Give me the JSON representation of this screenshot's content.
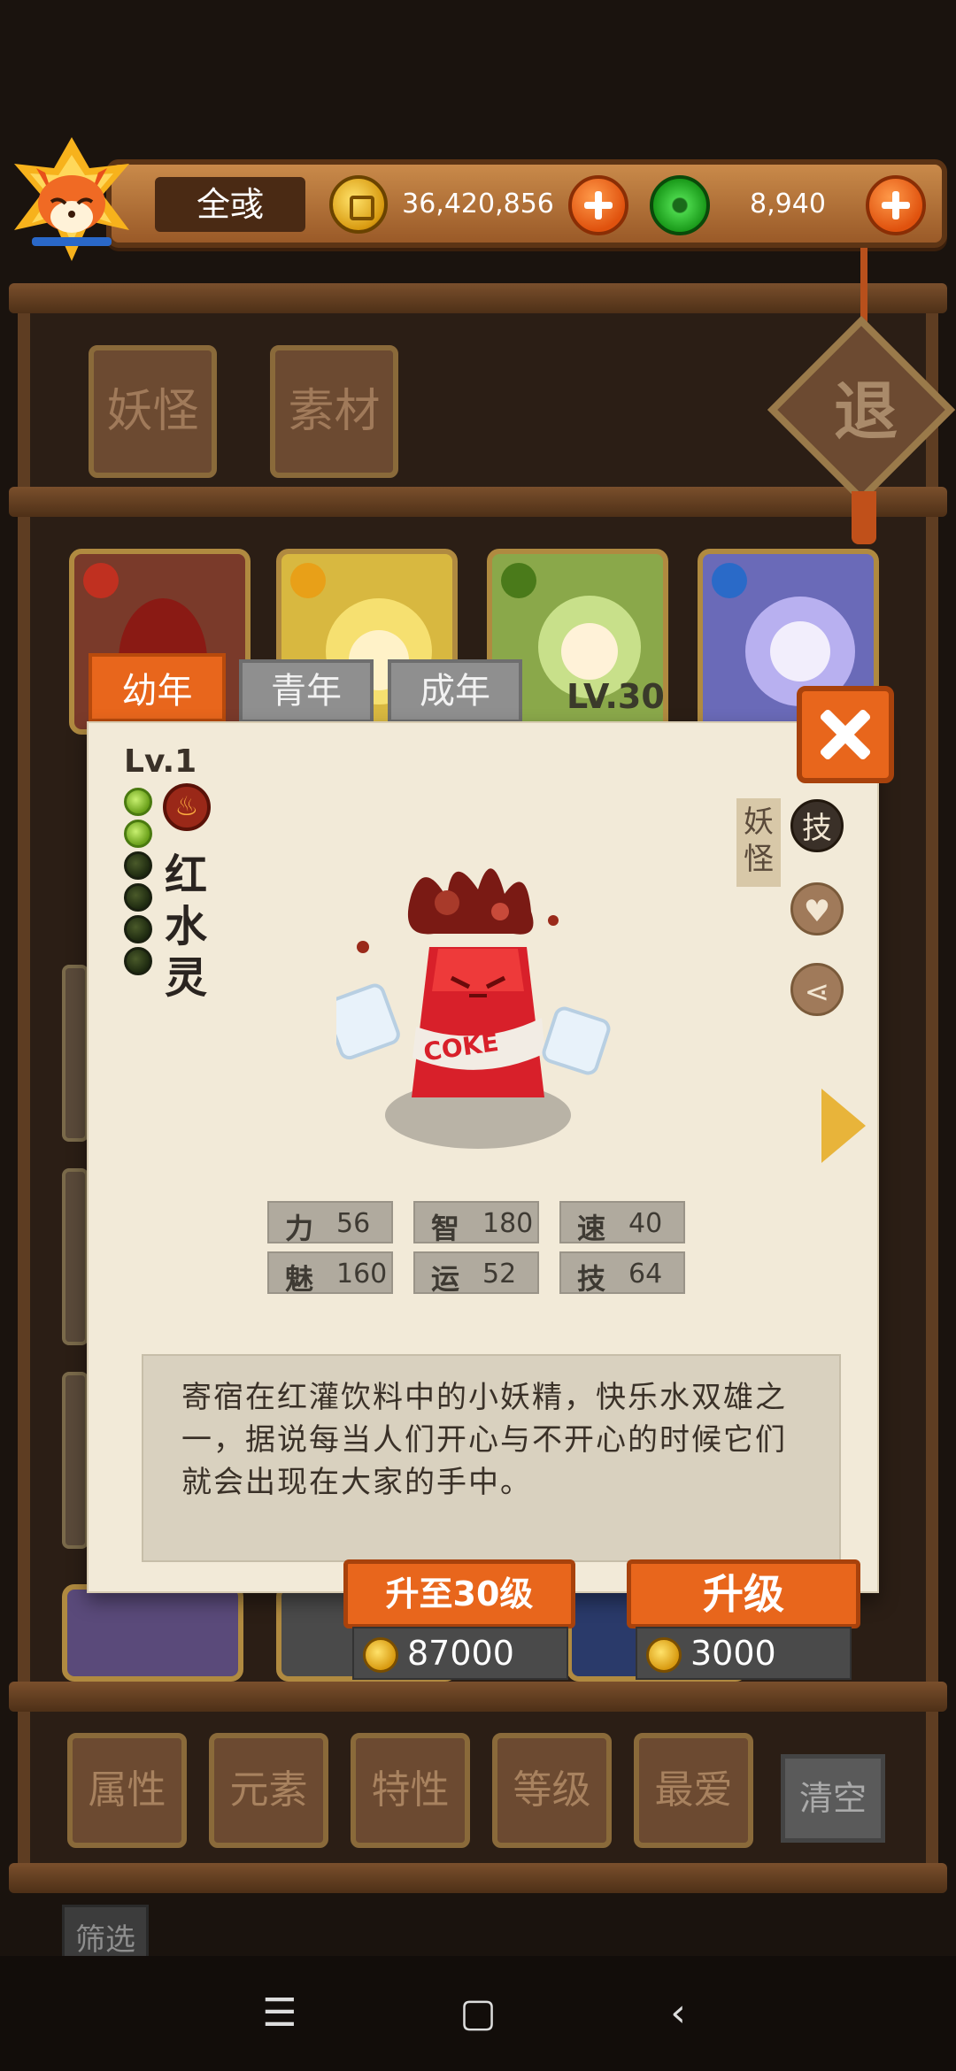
{
  "hud": {
    "player_name": "全彧",
    "coins": "36,420,856",
    "jade": "8,940"
  },
  "exit_label": "退",
  "top_tabs": [
    "妖怪",
    "素材"
  ],
  "card_level": "LV.30",
  "age_tabs": [
    "幼年",
    "青年",
    "成年"
  ],
  "detail": {
    "level": "Lv.1",
    "name_chars": [
      "红",
      "水",
      "灵"
    ],
    "type_tag": "妖怪",
    "skill_icon_label": "技",
    "stats": [
      {
        "key": "力",
        "value": "56"
      },
      {
        "key": "智",
        "value": "180"
      },
      {
        "key": "速",
        "value": "40"
      },
      {
        "key": "魅",
        "value": "160"
      },
      {
        "key": "运",
        "value": "52"
      },
      {
        "key": "技",
        "value": "64"
      }
    ],
    "description": "寄宿在红灌饮料中的小妖精，快乐水双雄之一，据说每当人们开心与不开心的时候它们就会出现在大家的手中。",
    "upgrade30_label": "升至30级",
    "upgrade30_cost": "87000",
    "upgrade_label": "升级",
    "upgrade_cost": "3000",
    "can_text": "COKE"
  },
  "filters": [
    "属性",
    "元素",
    "特性",
    "等级",
    "最爱"
  ],
  "clear_label": "清空",
  "screen_label": "筛选",
  "nav": {
    "menu": "☰",
    "home": "▢",
    "back": "‹"
  }
}
